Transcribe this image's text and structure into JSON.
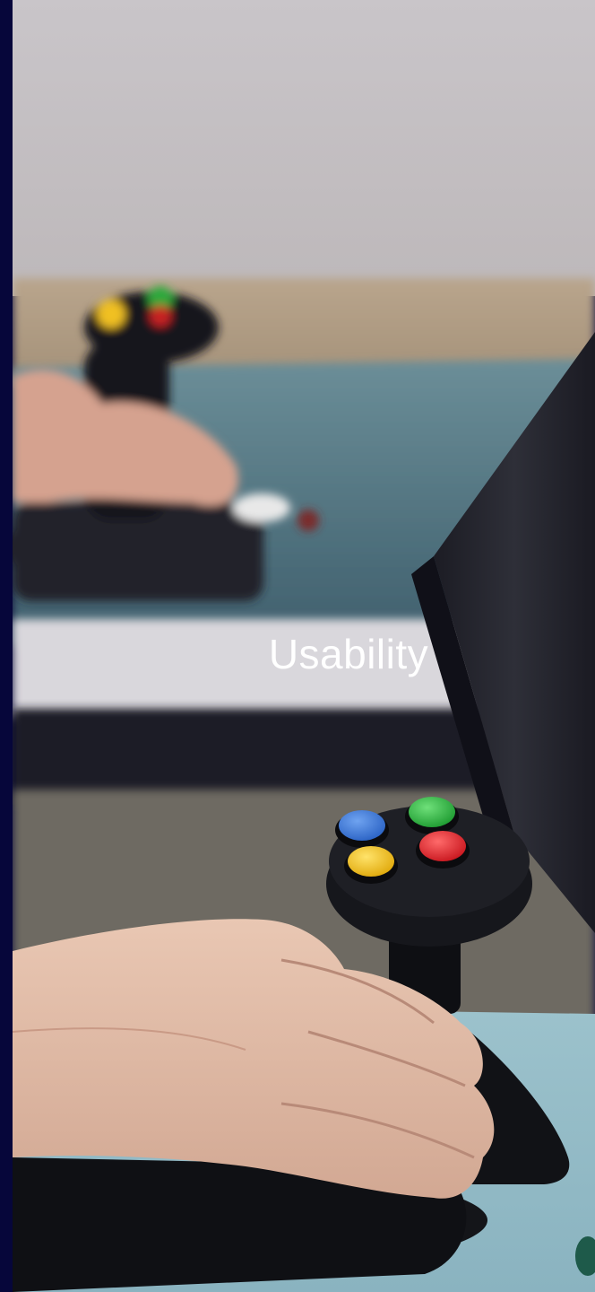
{
  "slide": {
    "caption": "Usability"
  },
  "colors": {
    "background": "#0a0a3a",
    "wall": "#c8c4c8",
    "desk": "#8fb3be",
    "caption_text": "#ffffff",
    "button_blue": "#2f6fd6",
    "button_green": "#22b03a",
    "button_red": "#e0232a",
    "button_yellow": "#f2c21a"
  },
  "icons": {
    "joystick_background": "joystick-icon",
    "joystick_foreground": "joystick-icon",
    "monitor": "monitor-icon"
  }
}
